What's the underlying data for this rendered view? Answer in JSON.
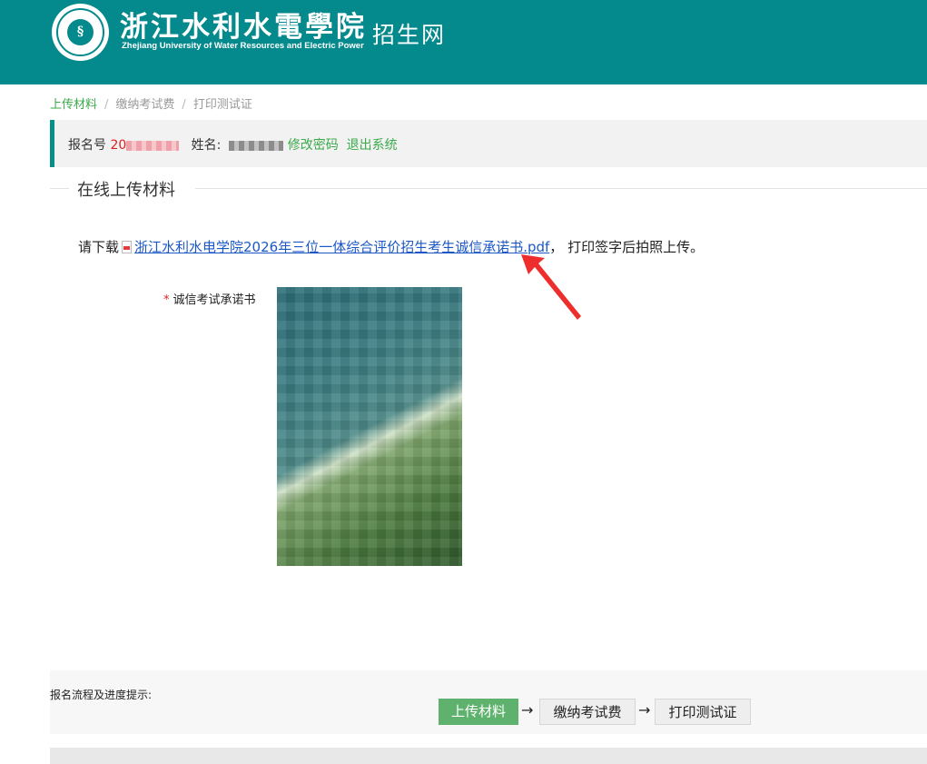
{
  "header": {
    "school_name_cn": "浙江水利水電學院",
    "school_name_en": "Zhejiang University of Water Resources and Electric Power",
    "site_title": "招生网"
  },
  "breadcrumb": {
    "items": [
      "上传材料",
      "缴纳考试费",
      "打印测试证"
    ],
    "separator": "/"
  },
  "info_bar": {
    "reg_label": "报名号",
    "reg_value": "20",
    "name_label": "姓名:",
    "change_password": "修改密码",
    "logout": "退出系统"
  },
  "section": {
    "title": "在线上传材料"
  },
  "download": {
    "prefix": "请下载",
    "file_link": "浙江水利水电学院2026年三位一体综合评价招生考生诚信承诺书.pdf",
    "suffix": "， 打印签字后拍照上传。"
  },
  "upload_field": {
    "required_mark": "*",
    "label": "诚信考试承诺书"
  },
  "process": {
    "label": "报名流程及进度提示:",
    "steps": [
      "上传材料",
      "缴纳考试费",
      "打印测试证"
    ],
    "arrow": "→"
  },
  "colors": {
    "header_bg": "#04898c",
    "accent_green": "#3aaa4a",
    "link_blue": "#1b58c6",
    "required_red": "#e02020",
    "step_done_bg": "#5fb26d"
  }
}
